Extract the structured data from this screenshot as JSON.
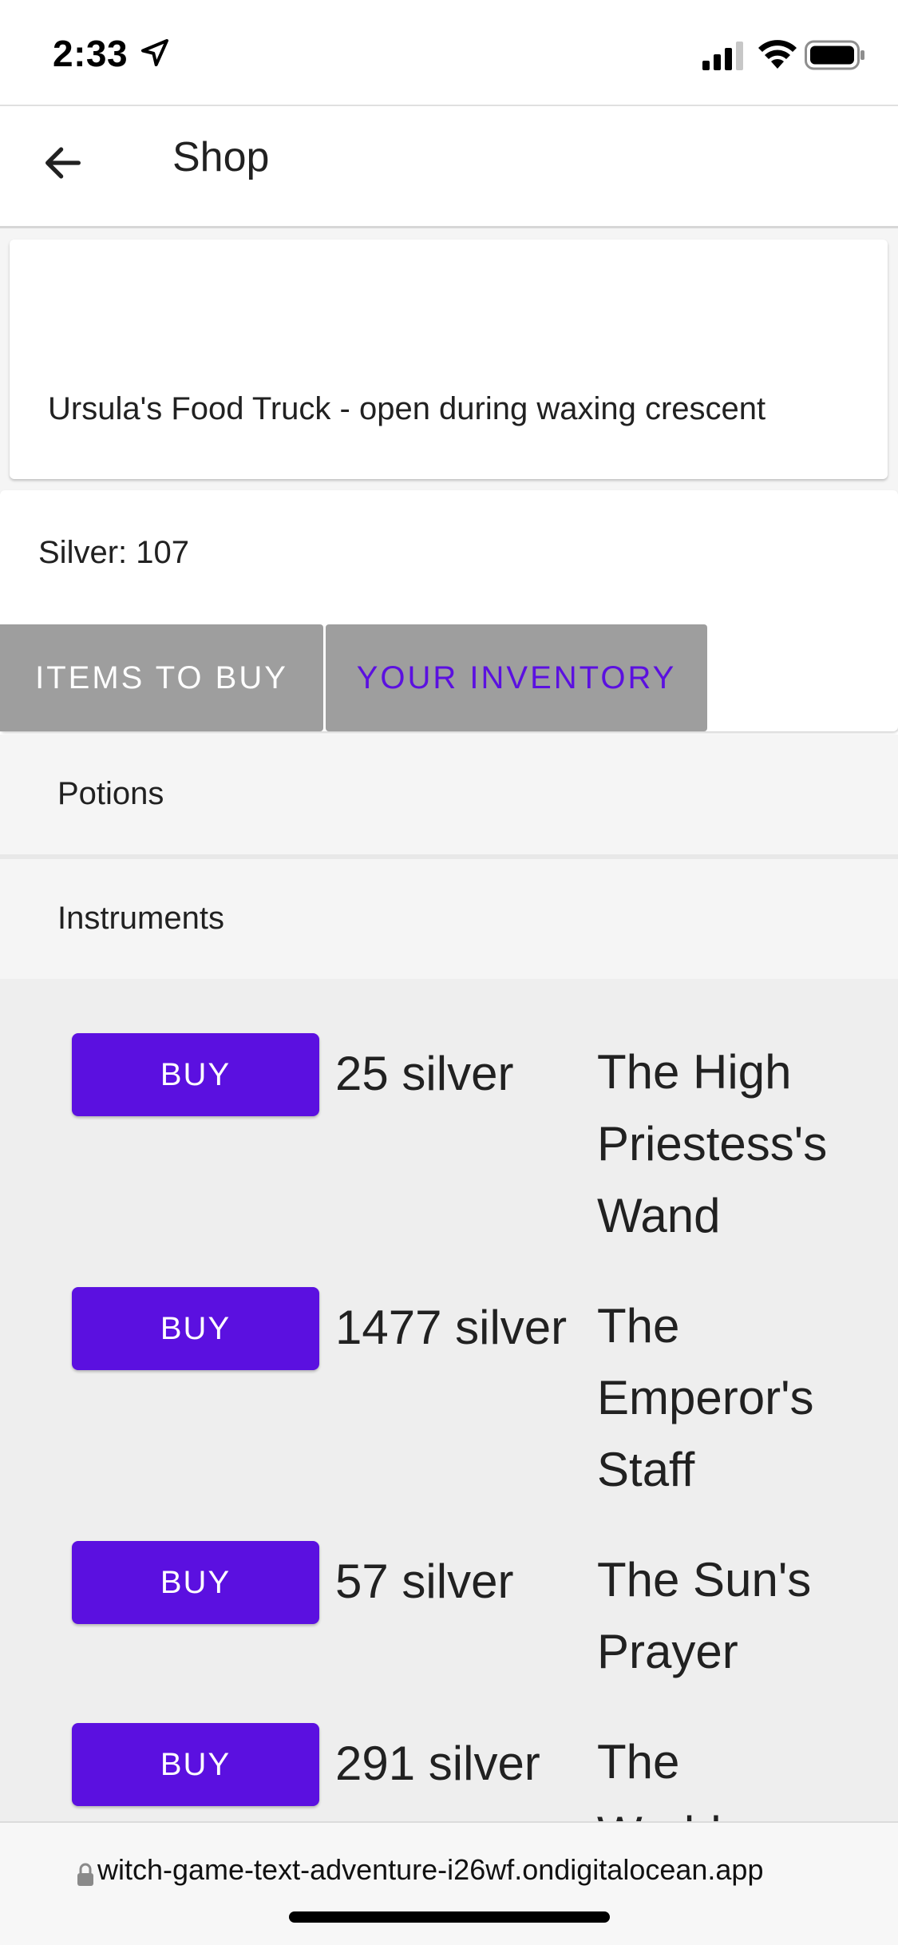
{
  "status": {
    "time": "2:33"
  },
  "app_bar": {
    "title": "Shop"
  },
  "shop": {
    "description": "Ursula's Food Truck - open during waxing crescent"
  },
  "wallet": {
    "silver_text": "Silver: 107"
  },
  "tabs": [
    {
      "label": "ITEMS TO BUY"
    },
    {
      "label": "YOUR INVENTORY"
    }
  ],
  "panels": [
    {
      "label": "Potions"
    },
    {
      "label": "Instruments"
    }
  ],
  "items": [
    {
      "buy_label": "BUY",
      "price": "25 silver",
      "name": "The High Priestess's Wand"
    },
    {
      "buy_label": "BUY",
      "price": "1477 silver",
      "name": "The Emperor's Staff"
    },
    {
      "buy_label": "BUY",
      "price": "57 silver",
      "name": "The Sun's Prayer"
    },
    {
      "buy_label": "BUY",
      "price": "291 silver",
      "name": "The World..."
    }
  ],
  "browser": {
    "url": "witch-game-text-adventure-i26wf.ondigitalocean.app"
  },
  "colors": {
    "accent": "#5b10e0",
    "tab_bg": "#9e9e9e",
    "panel_bg": "#f5f5f5"
  },
  "icons": [
    "location-arrow-icon",
    "signal-icon",
    "wifi-icon",
    "battery-icon",
    "back-arrow-icon",
    "lock-icon"
  ]
}
